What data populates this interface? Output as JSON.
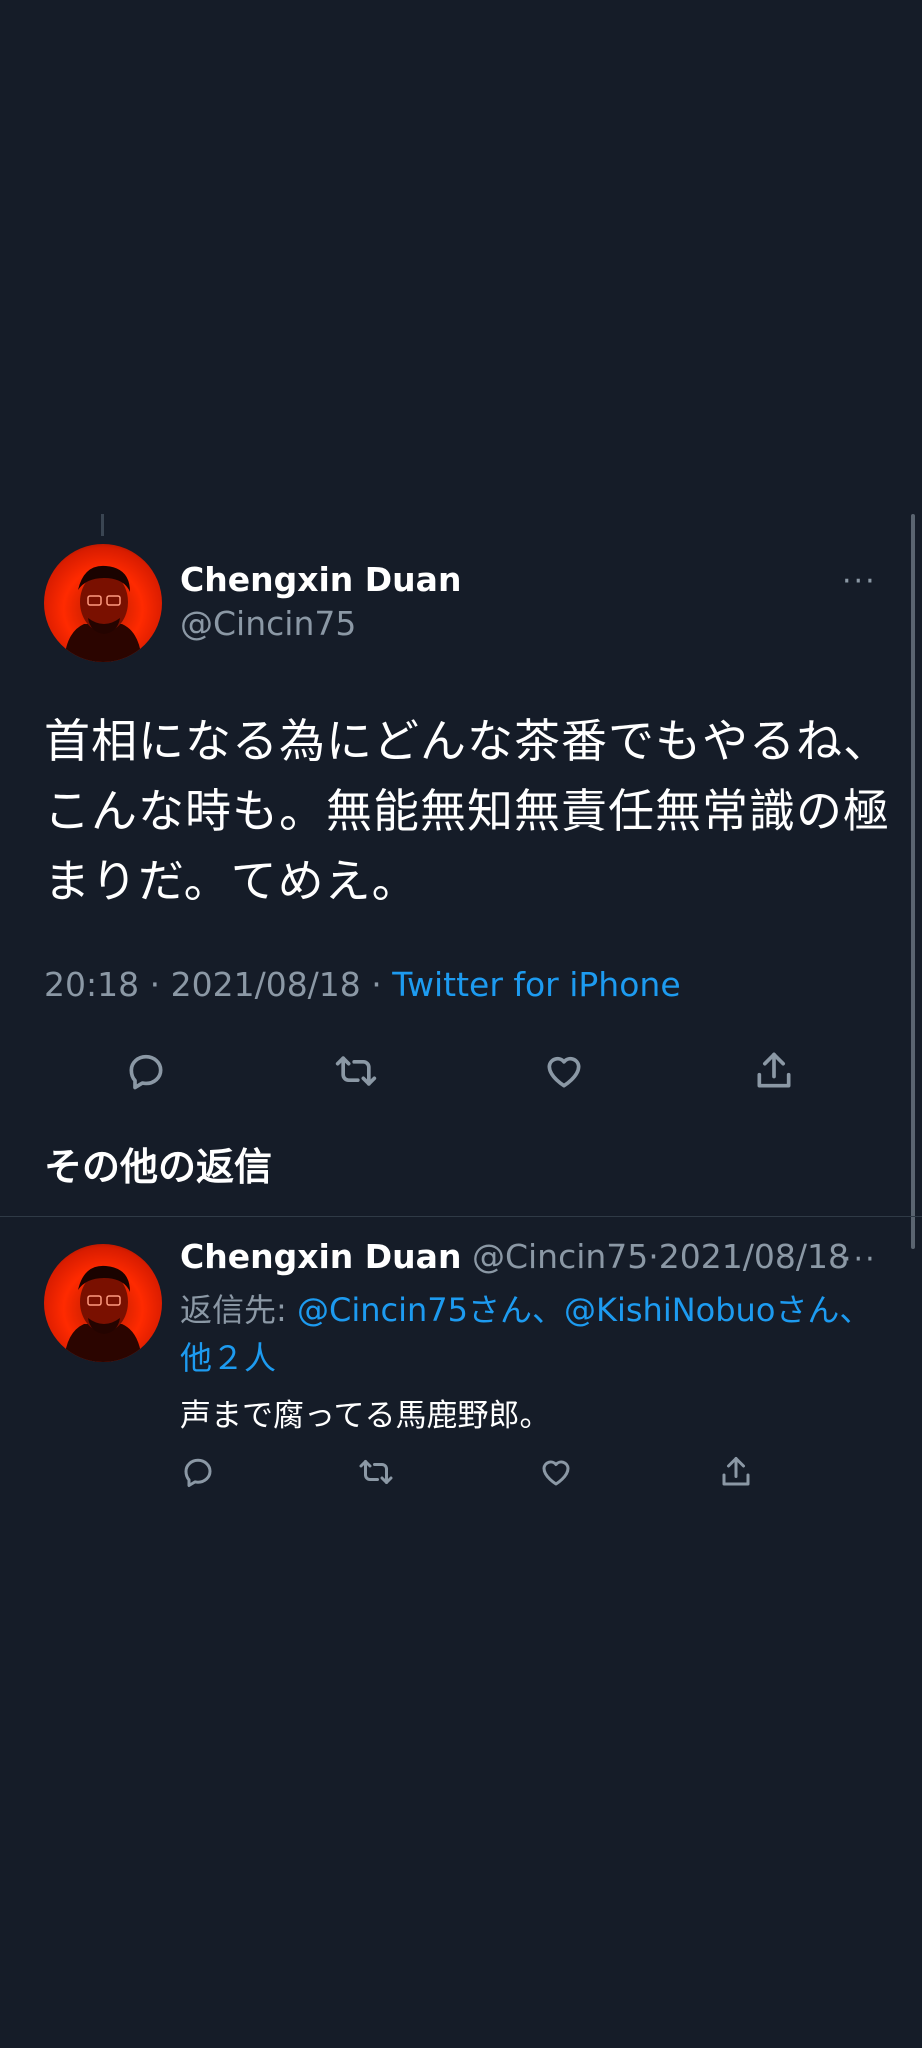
{
  "tweet": {
    "author_name": "Chengxin Duan",
    "author_handle": "@Cincin75",
    "more": "···",
    "text_line1": "首相になる為にどんな茶番でもやるね、",
    "text_line2": "こんな時も。無能無知無責任無常識の極",
    "text_line3": "まりだ。てめえ。",
    "time": "20:18",
    "sep1": " · ",
    "date": "2021/08/18",
    "sep2": " · ",
    "source": "Twitter for iPhone"
  },
  "actions": {
    "reply_icon": "reply-icon",
    "retweet_icon": "retweet-icon",
    "like_icon": "heart-icon",
    "share_icon": "share-icon"
  },
  "section": {
    "title": "その他の返信"
  },
  "reply": {
    "author_name": "Chengxin Duan",
    "author_handle": "@Cincin75",
    "sep": "·",
    "date": "2021/08/18",
    "more": "···",
    "reply_to_label": "返信先: ",
    "mention1": "@Cincin75",
    "san1": "さん、",
    "mention2": "@KishiNobuo",
    "san2": "さん、",
    "others": "他２人",
    "text": "声まで腐ってる馬鹿野郎。"
  },
  "colors": {
    "background": "#151c28",
    "accent": "#1d9bf0",
    "secondary_text": "#8b98a5"
  }
}
